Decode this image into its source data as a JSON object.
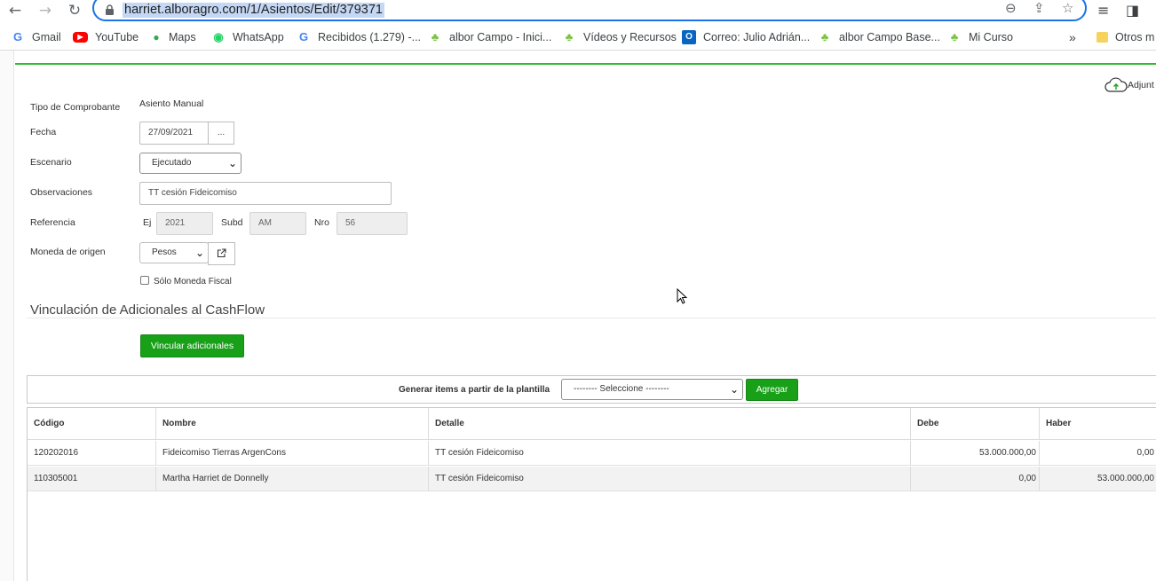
{
  "browser": {
    "url": "harriet.alboragro.com/1/Asientos/Edit/379371",
    "nav": {
      "back": "←",
      "forward": "→",
      "reload": "↻"
    },
    "icons": {
      "zoom": "zoom-icon",
      "share": "share-icon",
      "star": "star-icon",
      "reading_list": "reading-list-icon",
      "side_panel": "side-panel-icon"
    }
  },
  "bookmarks": [
    {
      "label": "Gmail",
      "icon": "G",
      "color": "#4285f4"
    },
    {
      "label": "YouTube",
      "icon": "▶",
      "color": "#ff0000"
    },
    {
      "label": "Maps",
      "icon": "⬤",
      "color": "#34a853"
    },
    {
      "label": "WhatsApp",
      "icon": "◉",
      "color": "#25d366"
    },
    {
      "label": "Recibidos (1.279) -...",
      "icon": "G",
      "color": "#4285f4"
    },
    {
      "label": "albor Campo - Inici...",
      "icon": "♣",
      "color": "#7cc242"
    },
    {
      "label": "Vídeos y Recursos",
      "icon": "♣",
      "color": "#7cc242"
    },
    {
      "label": "Correo: Julio Adrián...",
      "icon": "O",
      "color": "#0a64c2"
    },
    {
      "label": "albor Campo Base...",
      "icon": "♣",
      "color": "#7cc242"
    },
    {
      "label": "Mi Curso",
      "icon": "♣",
      "color": "#7cc242"
    }
  ],
  "bookmarks_more": "»",
  "bookmarks_other": "Otros m",
  "form": {
    "adjuntar": "Adjunt",
    "tipo_label": "Tipo de Comprobante",
    "tipo_value": "Asiento Manual",
    "fecha_label": "Fecha",
    "fecha_value": "27/09/2021",
    "fecha_picker": "...",
    "escenario_label": "Escenario",
    "escenario_value": "Ejecutado",
    "observaciones_label": "Observaciones",
    "observaciones_value": "TT cesión Fideicomiso",
    "referencia_label": "Referencia",
    "ej_label": "Ej",
    "ej_value": "2021",
    "subd_label": "Subd",
    "subd_value": "AM",
    "nro_label": "Nro",
    "nro_value": "56",
    "moneda_label": "Moneda de origen",
    "moneda_value": "Pesos",
    "solo_moneda_fiscal": "Sólo Moneda Fiscal"
  },
  "cashflow": {
    "title": "Vinculación de Adicionales al CashFlow",
    "vincular_label": "Vincular adicionales"
  },
  "template": {
    "label": "Generar items a partir de la plantilla",
    "select_value": "-------- Seleccione --------",
    "agregar_label": "Agregar"
  },
  "table": {
    "headers": [
      "Código",
      "Nombre",
      "Detalle",
      "Debe",
      "Haber"
    ],
    "rows": [
      [
        "120202016",
        "Fideicomiso Tierras ArgenCons",
        "TT cesión Fideicomiso",
        "53.000.000,00",
        "0,00"
      ],
      [
        "110305001",
        "Martha Harriet de Donnelly",
        "TT cesión Fideicomiso",
        "0,00",
        "53.000.000,00"
      ]
    ]
  },
  "colors": {
    "accent_green": "#19a019",
    "rule_green": "#2bbb2b",
    "omnibox_blue": "#1a73e8"
  }
}
